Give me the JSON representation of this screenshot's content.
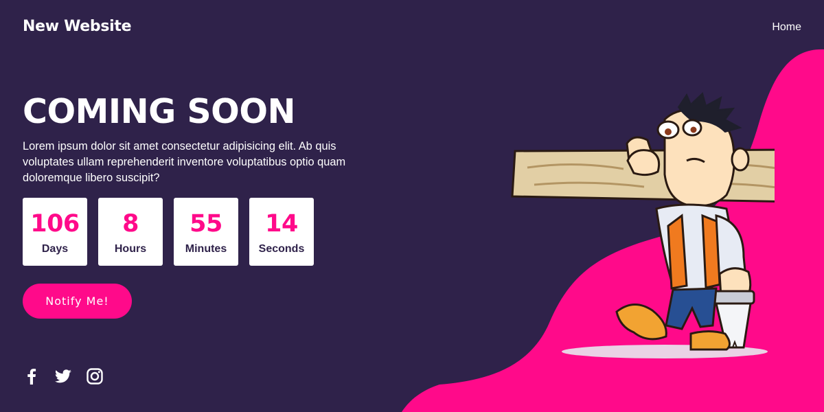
{
  "header": {
    "brand": "New Website",
    "nav": {
      "home": "Home"
    }
  },
  "hero": {
    "title": "COMING SOON",
    "description": "Lorem ipsum dolor sit amet consectetur adipisicing elit. Ab quis voluptates ullam reprehenderit inventore voluptatibus optio quam doloremque libero suscipit?",
    "countdown": [
      {
        "value": "106",
        "label": "Days"
      },
      {
        "value": "8",
        "label": "Hours"
      },
      {
        "value": "55",
        "label": "Minutes"
      },
      {
        "value": "14",
        "label": "Seconds"
      }
    ],
    "button": "Notify Me!"
  },
  "socials": [
    {
      "icon": "facebook-icon"
    },
    {
      "icon": "twitter-icon"
    },
    {
      "icon": "instagram-icon"
    }
  ],
  "colors": {
    "background": "#2f224a",
    "accent": "#ff0a8a",
    "text": "#ffffff"
  }
}
